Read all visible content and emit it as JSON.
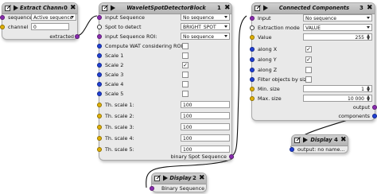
{
  "colors": {
    "port_object": "#1f3fd6",
    "port_sequence": "#8a2bb0",
    "port_number": "#e0b000",
    "block_background": "#e9e9e9",
    "header_background": "#c1c1c1"
  },
  "icons": [
    "edit-icon",
    "play-icon",
    "close-icon",
    "port-dot-icon",
    "link-wire"
  ],
  "blocks": {
    "extract": {
      "title": "Extract Channel",
      "number": "0",
      "close": "✖",
      "inputs": [
        {
          "label": "sequence",
          "value": "Active sequence"
        },
        {
          "label": "channel",
          "value": "0"
        }
      ],
      "output_label": "extracted"
    },
    "wavelet": {
      "title": "WaveletSpotDetectorBlock",
      "number": "1",
      "close": "✖",
      "selects": [
        {
          "label": "input Sequence",
          "value": "No sequence"
        },
        {
          "label": "Spot to detect",
          "value": "BRIGHT_SPOT"
        },
        {
          "label": "input Sequence ROI:",
          "value": "No sequence"
        }
      ],
      "checks": [
        {
          "label": "Compute WAT considering ROI",
          "checked": false
        },
        {
          "label": "Scale 1",
          "checked": false
        },
        {
          "label": "Scale 2",
          "checked": true
        },
        {
          "label": "Scale 3",
          "checked": false
        },
        {
          "label": "Scale 4",
          "checked": false
        },
        {
          "label": "Scale 5",
          "checked": false
        }
      ],
      "thresholds": [
        {
          "label": "Th. scale 1:",
          "value": "100"
        },
        {
          "label": "Th. scale 2:",
          "value": "100"
        },
        {
          "label": "Th. scale 3:",
          "value": "100"
        },
        {
          "label": "Th. scale 4:",
          "value": "100"
        },
        {
          "label": "Th. scale 5:",
          "value": "100"
        }
      ],
      "output_label": "binary Spot Sequence"
    },
    "components": {
      "title": "Connected Components",
      "number": "3",
      "close": "✖",
      "input": {
        "label": "Input",
        "value": "No sequence"
      },
      "mode": {
        "label": "Extraction mode",
        "value": "VALUE"
      },
      "value": {
        "label": "Value",
        "value": "255"
      },
      "checks": [
        {
          "label": "along X",
          "checked": true
        },
        {
          "label": "along Y",
          "checked": true
        },
        {
          "label": "along Z",
          "checked": false
        },
        {
          "label": "Filter objects by size",
          "checked": false
        }
      ],
      "min_size": {
        "label": "Min. size",
        "value": "1"
      },
      "max_size": {
        "label": "Max. size",
        "value": "10 000"
      },
      "outputs": [
        "output",
        "components"
      ]
    },
    "display4": {
      "title": "Display",
      "number": "4",
      "close": "✖",
      "input_label": "output: no name..."
    },
    "display2": {
      "title": "Display",
      "number": "2",
      "close": "✖",
      "input_label": "Binary Sequence"
    }
  }
}
